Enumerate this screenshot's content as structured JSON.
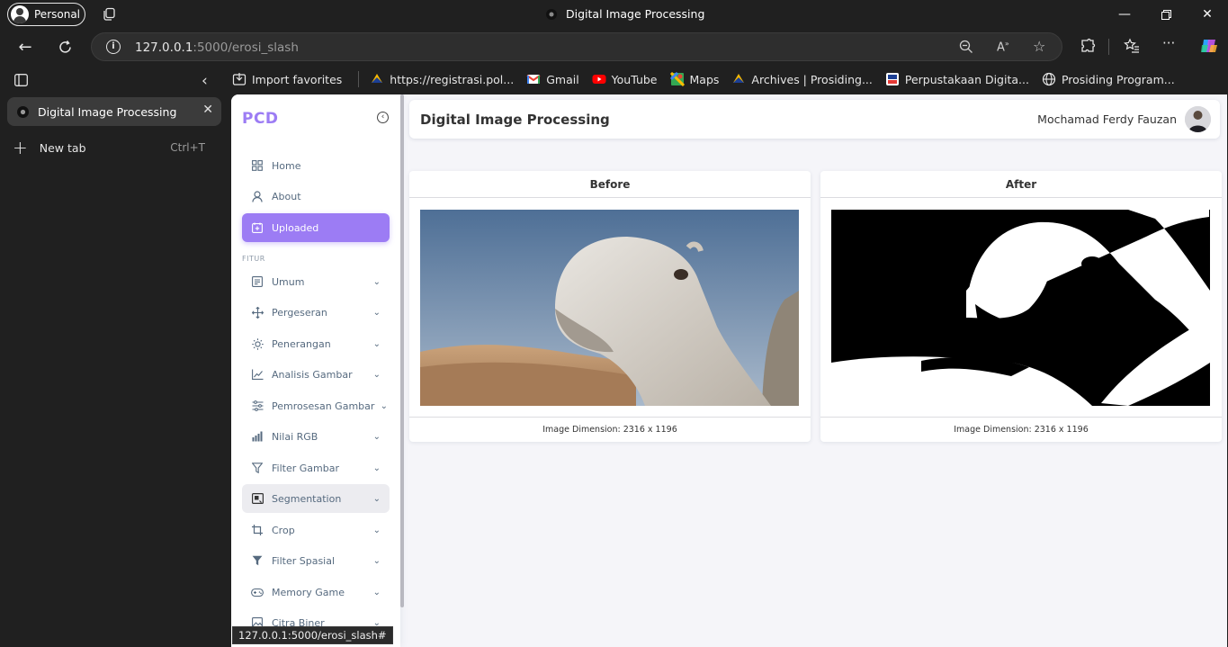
{
  "browser": {
    "profile_label": "Personal",
    "window_title": "Digital Image Processing",
    "url_host": "127.0.0.1",
    "url_rest": ":5000/erosi_slash",
    "status_url": "127.0.0.1:5000/erosi_slash#"
  },
  "bookmarks": [
    {
      "label": "Import favorites",
      "icon": "import-icon"
    },
    {
      "label": "https://registrasi.pol...",
      "icon": "polban-icon"
    },
    {
      "label": "Gmail",
      "icon": "gmail-icon"
    },
    {
      "label": "YouTube",
      "icon": "youtube-icon"
    },
    {
      "label": "Maps",
      "icon": "maps-icon"
    },
    {
      "label": "Archives | Prosiding...",
      "icon": "polban-icon"
    },
    {
      "label": "Perpustakaan Digita...",
      "icon": "library-icon"
    },
    {
      "label": "Prosiding Program...",
      "icon": "globe-icon"
    }
  ],
  "tabs": {
    "active_label": "Digital Image Processing",
    "new_tab_label": "New tab",
    "new_tab_shortcut": "Ctrl+T"
  },
  "app": {
    "brand": "PCD",
    "page_title": "Digital Image Processing",
    "user_name": "Mochamad Ferdy Fauzan",
    "accent": "#9c7cf4",
    "menu_top": [
      {
        "label": "Home",
        "icon": "grid-icon"
      },
      {
        "label": "About",
        "icon": "user-icon"
      },
      {
        "label": "Uploaded",
        "icon": "calendar-plus-icon",
        "active": true
      }
    ],
    "section_header": "FITUR",
    "menu_fitur": [
      {
        "label": "Umum",
        "icon": "list-icon"
      },
      {
        "label": "Pergeseran",
        "icon": "move-icon"
      },
      {
        "label": "Penerangan",
        "icon": "sun-icon"
      },
      {
        "label": "Analisis Gambar",
        "icon": "chart-line-icon"
      },
      {
        "label": "Pemrosesan Gambar",
        "icon": "sliders-icon"
      },
      {
        "label": "Nilai RGB",
        "icon": "bars-icon"
      },
      {
        "label": "Filter Gambar",
        "icon": "filter-icon"
      },
      {
        "label": "Segmentation",
        "icon": "segment-icon",
        "hover": true
      },
      {
        "label": "Crop",
        "icon": "crop-icon"
      },
      {
        "label": "Filter Spasial",
        "icon": "filter-solid-icon"
      },
      {
        "label": "Memory Game",
        "icon": "gamepad-icon"
      },
      {
        "label": "Citra Biner",
        "icon": "image-icon"
      }
    ],
    "before_card": {
      "title": "Before",
      "caption": "Image Dimension: 2316 x 1196"
    },
    "after_card": {
      "title": "After",
      "caption": "Image Dimension: 2316 x 1196"
    }
  }
}
